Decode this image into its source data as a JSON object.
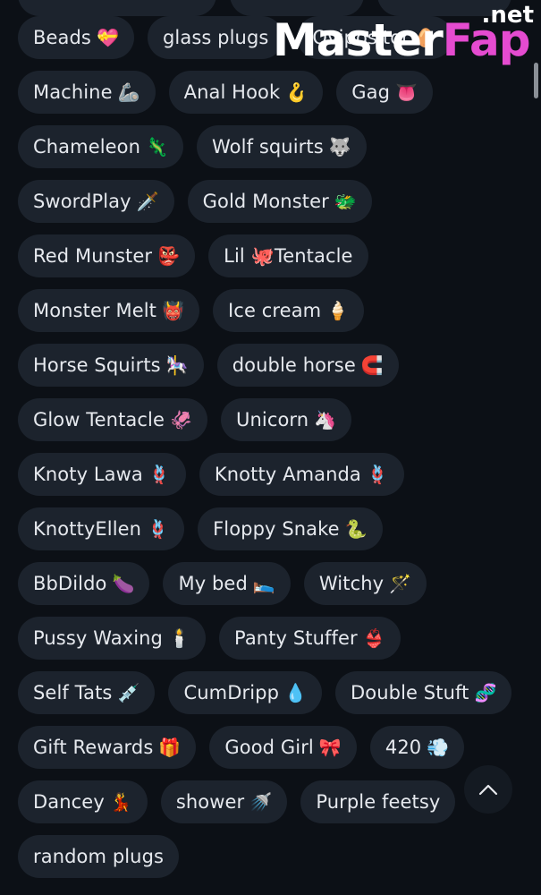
{
  "watermark": {
    "main": "Master",
    "accent": "Fap",
    "tld": ".net"
  },
  "chips": [
    {
      "label": "Beads",
      "emoji": "💝",
      "icon": "heart-ribbon-icon"
    },
    {
      "label": "glass plugs",
      "emoji": "",
      "icon": ""
    },
    {
      "label": "Ovipositor",
      "emoji": "🥚",
      "icon": "egg-icon"
    },
    {
      "label": "Machine",
      "emoji": "🦾",
      "icon": "mechanical-arm-icon"
    },
    {
      "label": "Anal Hook",
      "emoji": "🪝",
      "icon": "hook-icon"
    },
    {
      "label": "Gag",
      "emoji": "👅",
      "icon": "tongue-icon"
    },
    {
      "label": "Chameleon",
      "emoji": "🦎",
      "icon": "lizard-icon"
    },
    {
      "label": "Wolf squirts",
      "emoji": "🐺",
      "icon": "wolf-icon"
    },
    {
      "label": "SwordPlay",
      "emoji": "🗡️",
      "icon": "dagger-icon"
    },
    {
      "label": "Gold Monster",
      "emoji": "🐲",
      "icon": "dragon-icon"
    },
    {
      "label": "Red Munster",
      "emoji": "👺",
      "icon": "goblin-icon"
    },
    {
      "label": "Lil 🐙Tentacle",
      "emoji": "",
      "icon": "octopus-icon"
    },
    {
      "label": "Monster Melt",
      "emoji": "👹",
      "icon": "ogre-icon"
    },
    {
      "label": "Ice cream",
      "emoji": "🍦",
      "icon": "ice-cream-icon"
    },
    {
      "label": "Horse Squirts",
      "emoji": "🎠",
      "icon": "carousel-horse-icon"
    },
    {
      "label": "double horse",
      "emoji": "🧲",
      "icon": "magnet-icon"
    },
    {
      "label": "Glow Tentacle",
      "emoji": "🦑",
      "icon": "squid-icon"
    },
    {
      "label": "Unicorn",
      "emoji": "🦄",
      "icon": "unicorn-icon"
    },
    {
      "label": "Knoty Lawa",
      "emoji": "🪢",
      "icon": "knot-icon"
    },
    {
      "label": "Knotty Amanda",
      "emoji": "🪢",
      "icon": "knot-icon"
    },
    {
      "label": "KnottyEllen",
      "emoji": "🪢",
      "icon": "knot-icon"
    },
    {
      "label": "Floppy Snake",
      "emoji": "🐍",
      "icon": "snake-icon"
    },
    {
      "label": "BbDildo",
      "emoji": "🍆",
      "icon": "eggplant-icon"
    },
    {
      "label": "My bed",
      "emoji": "🛌",
      "icon": "bed-icon"
    },
    {
      "label": "Witchy",
      "emoji": "🪄",
      "icon": "magic-wand-icon"
    },
    {
      "label": "Pussy Waxing",
      "emoji": "🕯️",
      "icon": "candle-icon"
    },
    {
      "label": "Panty Stuffer",
      "emoji": "👙",
      "icon": "bikini-icon"
    },
    {
      "label": "Self Tats",
      "emoji": "💉",
      "icon": "syringe-icon"
    },
    {
      "label": "CumDripp",
      "emoji": "💧",
      "icon": "droplet-icon"
    },
    {
      "label": "Double Stuft",
      "emoji": "🧬",
      "icon": "dna-icon"
    },
    {
      "label": "Gift Rewards",
      "emoji": "🎁",
      "icon": "gift-icon"
    },
    {
      "label": "Good Girl",
      "emoji": "🎀",
      "icon": "ribbon-icon"
    },
    {
      "label": "420",
      "emoji": "💨",
      "icon": "smoke-puff-icon"
    },
    {
      "label": "Dancey",
      "emoji": "💃",
      "icon": "dancer-icon"
    },
    {
      "label": "shower",
      "emoji": "🚿",
      "icon": "shower-icon"
    },
    {
      "label": "Purple feetsy",
      "emoji": "",
      "icon": ""
    },
    {
      "label": "random plugs",
      "emoji": "",
      "icon": ""
    }
  ],
  "scroll_top_icon": "chevron-up-icon"
}
